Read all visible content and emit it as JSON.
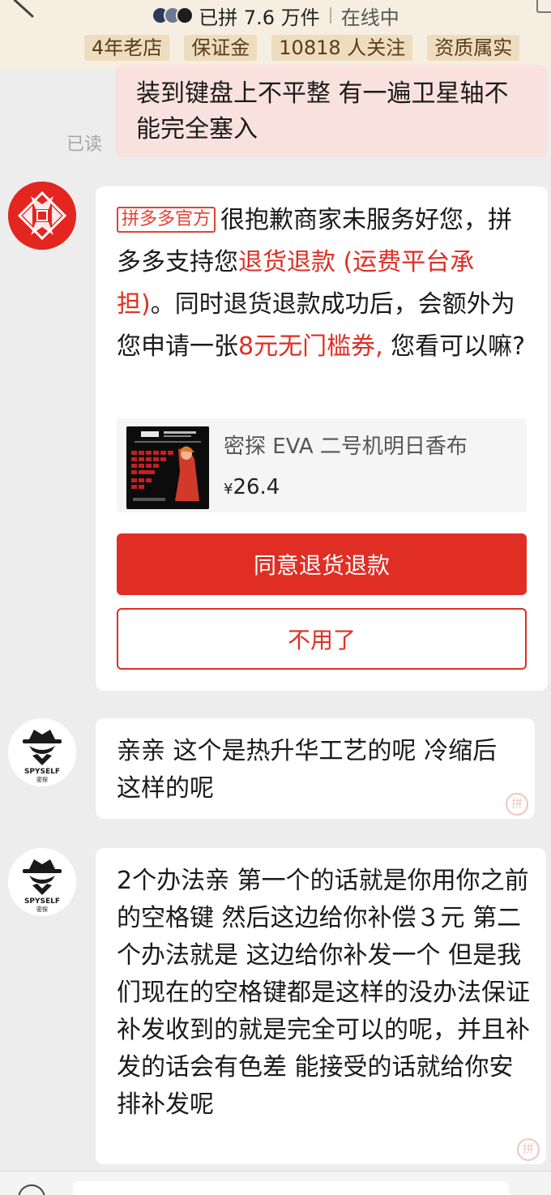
{
  "header": {
    "stats_text": "已拼 7.6 万件",
    "online_text": "在线中",
    "tags": [
      "4年老店",
      "保证金",
      "10818 人关注",
      "资质属实"
    ]
  },
  "messages": {
    "read_label": "已读",
    "outgoing_text": "装到键盘上不平整 有一遍卫星轴不能完全塞入",
    "official": {
      "badge": "拼多多官方",
      "text_1": "很抱歉商家未服务好您，拼多多支持您",
      "highlight_1": "退货退款 (运费平台承担)",
      "text_2": "。同时退货退款成功后，会额外为您申请一张",
      "highlight_2": "8元无门槛券,",
      "text_3": " 您看可以嘛?",
      "product": {
        "name": "密探 EVA 二号机明日香布",
        "currency": "¥",
        "price": "26.4"
      },
      "agree_button": "同意退货退款",
      "decline_button": "不用了"
    },
    "merchant_1": "亲亲 这个是热升华工艺的呢 冷缩后这样的呢",
    "merchant_2": "2个办法亲  第一个的话就是你用你之前的空格键 然后这边给你补偿３元   第二个办法就是 这边给你补发一个 但是我们现在的空格键都是这样的没办法保证补发收到的就是完全可以的呢，并且补发的话会有色差 能接受的话就给你安排补发呢",
    "avatar_brand": "SPYSELF",
    "avatar_brand_cn": "密探",
    "watermark": "拼"
  },
  "colors": {
    "accent_red": "#e02e24",
    "header_bg": "#f7eee2",
    "tag_bg": "#eedcbf"
  }
}
